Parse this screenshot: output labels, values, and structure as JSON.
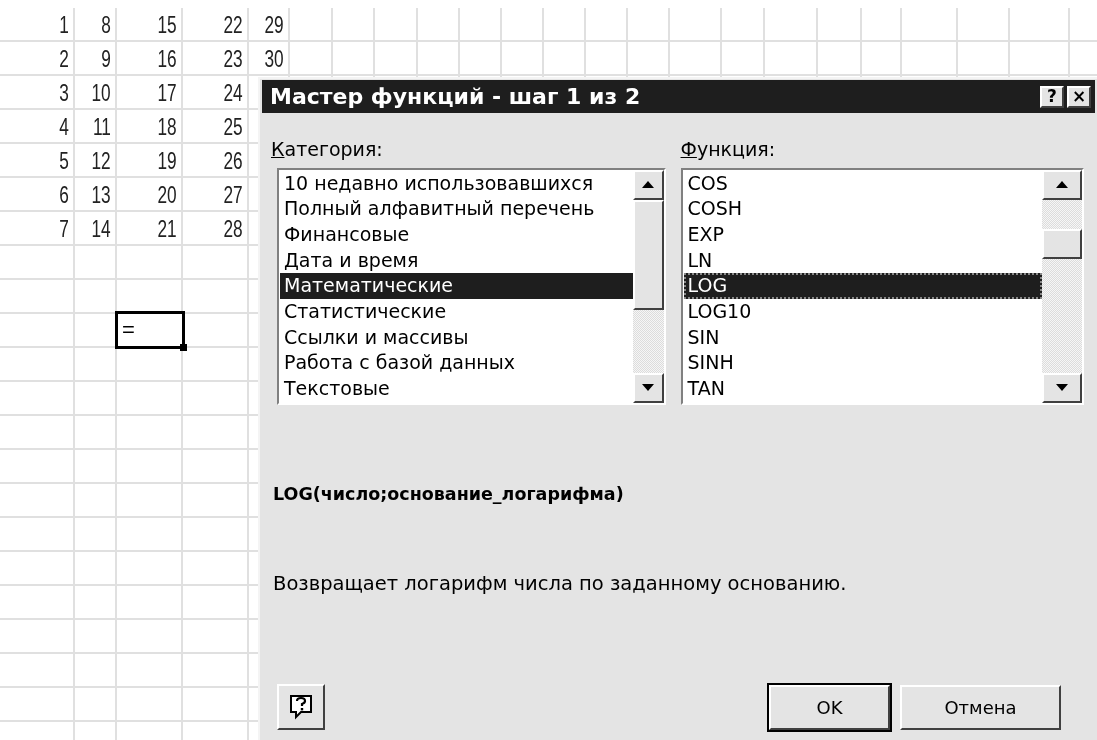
{
  "spreadsheet": {
    "columns": [
      [
        "1",
        "2",
        "3",
        "4",
        "5",
        "6",
        "7"
      ],
      [
        "8",
        "9",
        "10",
        "11",
        "12",
        "13",
        "14"
      ],
      [
        "15",
        "16",
        "17",
        "18",
        "19",
        "20",
        "21"
      ],
      [
        "22",
        "23",
        "24",
        "25",
        "26",
        "27",
        "28"
      ],
      [
        "29",
        "30"
      ]
    ],
    "active_cell": {
      "value": "="
    }
  },
  "dialog": {
    "title": "Мастер функций - шаг 1 из 2",
    "title_buttons": [
      "?",
      "×"
    ],
    "category": {
      "label": "Категория:",
      "items": [
        {
          "label": "10 недавно использовавшихся",
          "selected": false
        },
        {
          "label": "Полный алфавитный перечень",
          "selected": false
        },
        {
          "label": "Финансовые",
          "selected": false
        },
        {
          "label": "Дата и время",
          "selected": false
        },
        {
          "label": "Математические",
          "selected": true
        },
        {
          "label": "Статистические",
          "selected": false
        },
        {
          "label": "Ссылки и массивы",
          "selected": false
        },
        {
          "label": "Работа с базой данных",
          "selected": false
        },
        {
          "label": "Текстовые",
          "selected": false
        }
      ]
    },
    "function": {
      "label": "Функция:",
      "items": [
        {
          "label": "COS",
          "selected": false
        },
        {
          "label": "COSH",
          "selected": false
        },
        {
          "label": "EXP",
          "selected": false
        },
        {
          "label": "LN",
          "selected": false
        },
        {
          "label": "LOG",
          "selected": true
        },
        {
          "label": "LOG10",
          "selected": false
        },
        {
          "label": "SIN",
          "selected": false
        },
        {
          "label": "SINH",
          "selected": false
        },
        {
          "label": "TAN",
          "selected": false
        }
      ]
    },
    "syntax": "LOG(число;основание_логарифма)",
    "description": "Возвращает логарифм числа по заданному основанию.",
    "buttons": [
      {
        "label": "OK",
        "default": true
      },
      {
        "label": "Отмена",
        "default": false
      }
    ]
  }
}
